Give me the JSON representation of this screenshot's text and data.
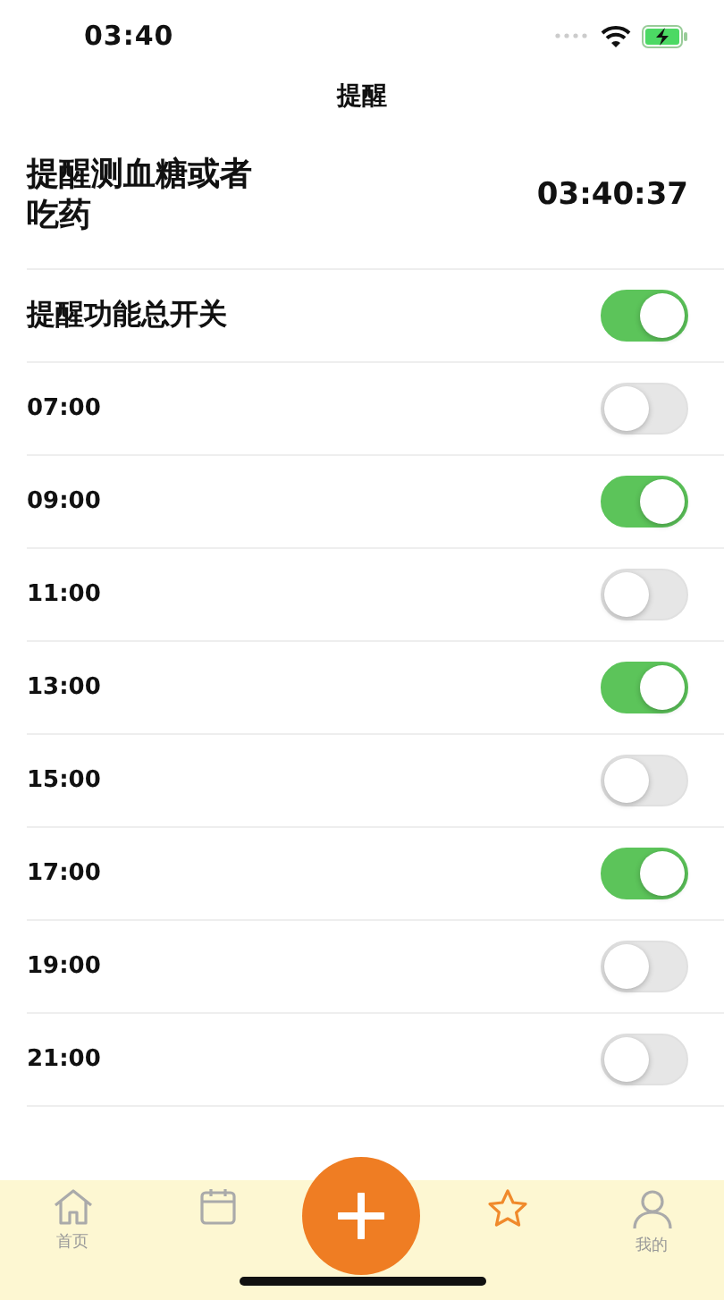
{
  "status_bar": {
    "time": "03:40"
  },
  "nav": {
    "title": "提醒"
  },
  "header": {
    "message": "提醒测血糖或者吃药",
    "clock": "03:40:37"
  },
  "master": {
    "label": "提醒功能总开关",
    "on": true
  },
  "reminders": [
    {
      "time": "07:00",
      "on": false
    },
    {
      "time": "09:00",
      "on": true
    },
    {
      "time": "11:00",
      "on": false
    },
    {
      "time": "13:00",
      "on": true
    },
    {
      "time": "15:00",
      "on": false
    },
    {
      "time": "17:00",
      "on": true
    },
    {
      "time": "19:00",
      "on": false
    },
    {
      "time": "21:00",
      "on": false
    }
  ],
  "tab_bar": [
    {
      "kind": "home",
      "label": "首页",
      "selected": false
    },
    {
      "kind": "calendar",
      "selected": false
    },
    {
      "kind": "add"
    },
    {
      "kind": "star",
      "selected": true
    },
    {
      "kind": "profile",
      "label": "我的",
      "selected": false
    }
  ]
}
